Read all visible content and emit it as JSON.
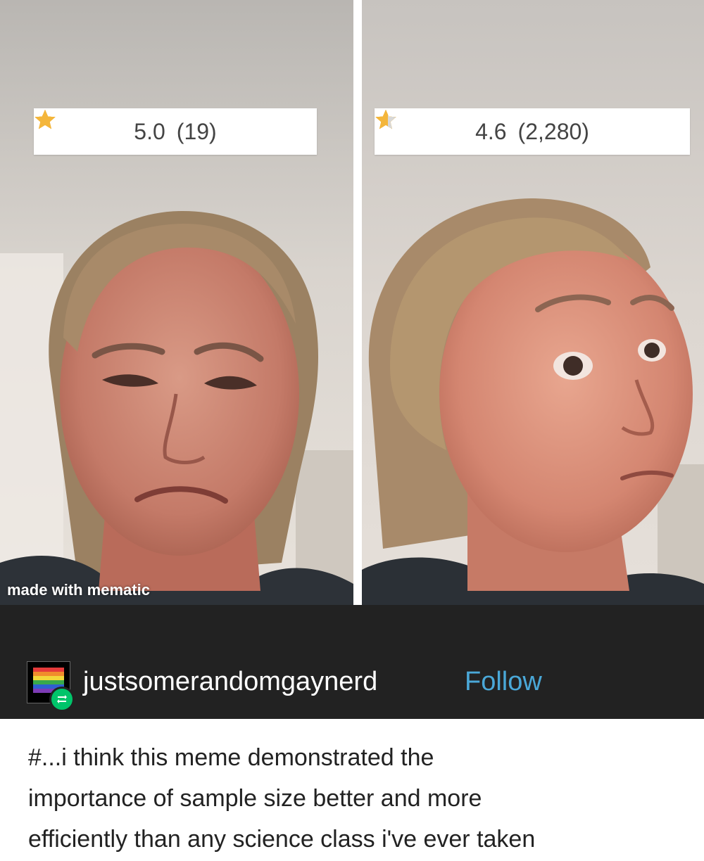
{
  "meme": {
    "left": {
      "rating_value": "5.0",
      "rating_stars": 5.0,
      "rating_count": "(19)"
    },
    "right": {
      "rating_value": "4.6",
      "rating_stars": 4.6,
      "rating_count": "(2,280)"
    },
    "watermark": "made with mematic",
    "star_color": "#f4b63b"
  },
  "post": {
    "username": "justsomerandomgaynerd",
    "follow_label": "Follow",
    "avatar_icon": "rainbow-flag-avatar-icon",
    "reblog_icon": "reblog-icon",
    "follow_color": "#4aa8d8",
    "bar_color": "#222222",
    "tags_lines": [
      "#...i think this meme demonstrated the",
      "importance of sample size better and more",
      "efficiently than any science class i've ever taken"
    ]
  }
}
